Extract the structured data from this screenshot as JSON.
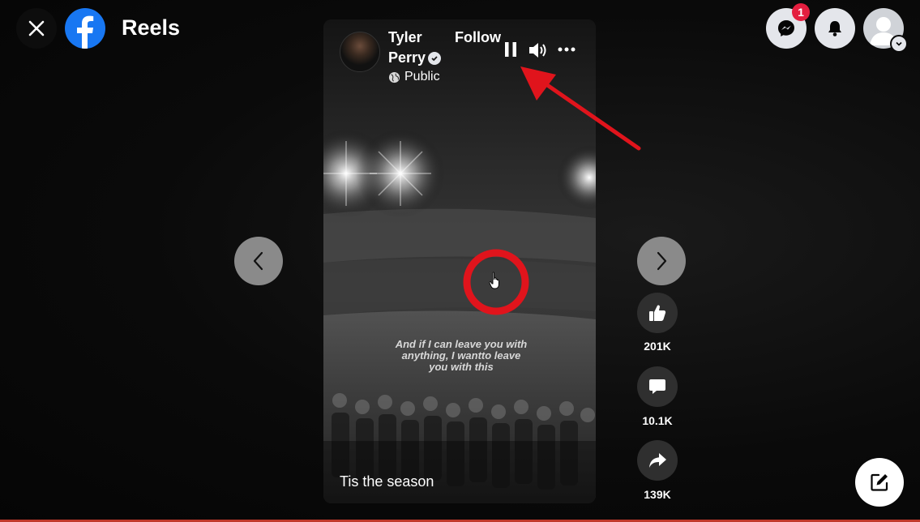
{
  "header": {
    "title": "Reels",
    "notification_count": "1"
  },
  "reel": {
    "author_name": "Tyler Perry",
    "follow_label": "Follow",
    "privacy": "Public",
    "caption_overlay": "And if I can leave you with anything, I wantto leave you with this",
    "title": "Tis the season"
  },
  "actions": {
    "likes": "201K",
    "comments": "10.1K",
    "shares": "139K"
  },
  "colors": {
    "facebook_blue": "#1877f2",
    "badge_red": "#e41e3f",
    "annotation_red": "#e0141c"
  },
  "icons": [
    "close-icon",
    "facebook-logo",
    "messenger-icon",
    "bell-icon",
    "avatar-icon",
    "pause-icon",
    "volume-icon",
    "more-icon",
    "globe-icon",
    "verified-icon",
    "chevron-left-icon",
    "chevron-right-icon",
    "like-icon",
    "comment-icon",
    "share-icon",
    "edit-icon",
    "cursor-hand-icon"
  ]
}
